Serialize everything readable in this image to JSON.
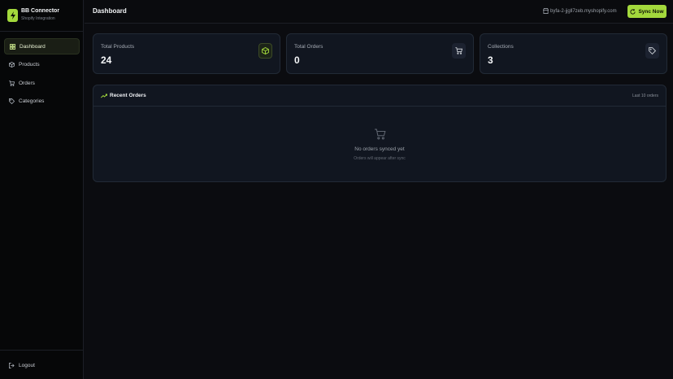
{
  "brand": {
    "title": "BB Connector",
    "subtitle": "Shopify Integration"
  },
  "sidebar": {
    "items": [
      {
        "label": "Dashboard",
        "icon": "dashboard-icon"
      },
      {
        "label": "Products",
        "icon": "box-icon"
      },
      {
        "label": "Orders",
        "icon": "cart-icon"
      },
      {
        "label": "Categories",
        "icon": "tag-icon"
      }
    ],
    "logout_label": "Logout"
  },
  "topbar": {
    "title": "Dashboard",
    "store_url": "byfa-2-jjgll7zeb.myshopify.com",
    "sync_label": "Sync Now"
  },
  "stats": [
    {
      "label": "Total Products",
      "value": "24",
      "icon": "box-icon"
    },
    {
      "label": "Total Orders",
      "value": "0",
      "icon": "cart-icon"
    },
    {
      "label": "Collections",
      "value": "3",
      "icon": "tag-icon"
    }
  ],
  "recent_orders": {
    "title": "Recent Orders",
    "meta": "Last 10 orders",
    "empty_title": "No orders synced yet",
    "empty_subtitle": "Orders will appear after sync"
  },
  "colors": {
    "accent": "#a3d93c",
    "background": "#0b0c10",
    "card": "#111620"
  }
}
